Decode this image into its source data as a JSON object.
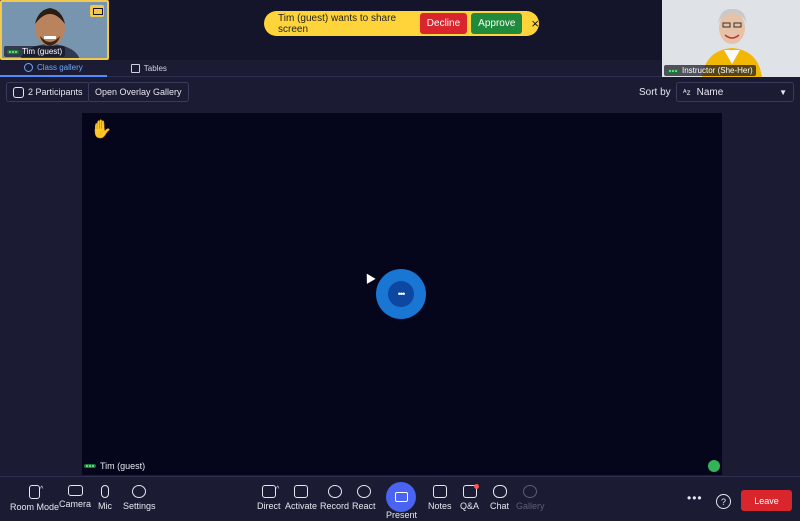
{
  "thumbnails": {
    "tim_name": "Tim (guest)",
    "instructor_name": "Instructor (She-Her)"
  },
  "notification": {
    "message": "Tim (guest) wants to share screen",
    "decline_label": "Decline",
    "approve_label": "Approve",
    "close_icon": "×"
  },
  "tabs": [
    {
      "label": "Class gallery",
      "icon": "globe-icon",
      "active": true
    },
    {
      "label": "Tables",
      "icon": "table-icon",
      "active": false
    }
  ],
  "controls": {
    "participants_label": "2 Participants",
    "overlay_label": "Open Overlay Gallery",
    "sort_label": "Sort by",
    "sort_value": "Name",
    "sort_icon_text": "ᴬᴢ",
    "caret": "▼"
  },
  "stage": {
    "participant_name": "Tim (guest)",
    "hand_icon": "✋",
    "center_icon_text": "•••"
  },
  "toolbar": {
    "room_mode": "Room Mode",
    "camera": "Camera",
    "mic": "Mic",
    "settings": "Settings",
    "direct": "Direct",
    "activate": "Activate",
    "record": "Record",
    "react": "React",
    "present": "Present",
    "notes": "Notes",
    "qa": "Q&A",
    "chat": "Chat",
    "gallery": "Gallery",
    "more": "•••",
    "help": "?",
    "leave": "Leave"
  },
  "colors": {
    "background": "#1b1c33",
    "stage": "#05061c",
    "notice": "#ffd43b",
    "decline": "#d9262c",
    "approve": "#1f8a3b",
    "accent": "#4a63f0",
    "leave": "#d9262c"
  }
}
